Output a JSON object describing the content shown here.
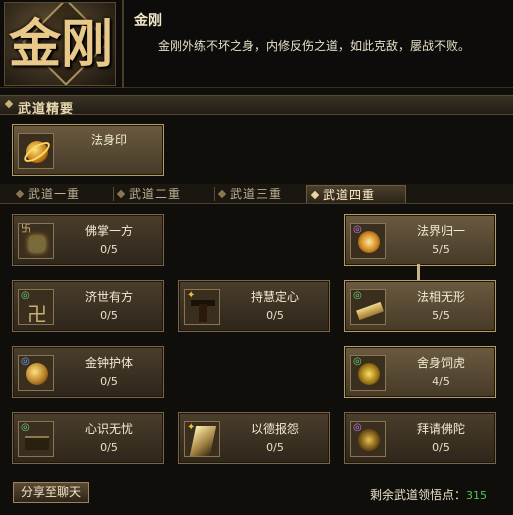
{
  "header": {
    "emblem_glyph": "金刚",
    "title": "金刚",
    "description": "金刚外练不坏之身，内修反伤之道，如此克敌，屡战不败。"
  },
  "section": {
    "label": "武道精要"
  },
  "core_skill": {
    "name": "法身印",
    "icon": "golden-swirl-icon"
  },
  "tabs": [
    {
      "label": "武道一重",
      "active": false
    },
    {
      "label": "武道二重",
      "active": false
    },
    {
      "label": "武道三重",
      "active": false
    },
    {
      "label": "武道四重",
      "active": true
    }
  ],
  "nodes": {
    "r1c1": {
      "name": "佛掌一方",
      "points": "0/5",
      "icon": "palm-icon"
    },
    "r1c3": {
      "name": "法界归一",
      "points": "5/5",
      "icon": "halo-icon"
    },
    "r2c1": {
      "name": "济世有方",
      "points": "0/5",
      "icon": "swastika-icon"
    },
    "r2c2": {
      "name": "持慧定心",
      "points": "0/5",
      "icon": "warrior-icon"
    },
    "r2c3": {
      "name": "法相无形",
      "points": "5/5",
      "icon": "scroll-icon"
    },
    "r3c1": {
      "name": "金钟护体",
      "points": "0/5",
      "icon": "bell-icon"
    },
    "r3c3": {
      "name": "舍身饲虎",
      "points": "4/5",
      "icon": "tiger-icon"
    },
    "r4c1": {
      "name": "心识无忧",
      "points": "0/5",
      "icon": "heart-icon"
    },
    "r4c2": {
      "name": "以德报怨",
      "points": "0/5",
      "icon": "light-icon"
    },
    "r4c3": {
      "name": "拜请佛陀",
      "points": "0/5",
      "icon": "buddha-icon"
    }
  },
  "footer": {
    "share_label": "分享至聊天",
    "remaining_label": "剩余武道领悟点：",
    "remaining_value": "315"
  },
  "colors": {
    "accent": "#c9b27a",
    "points_green": "#4ec94a"
  }
}
